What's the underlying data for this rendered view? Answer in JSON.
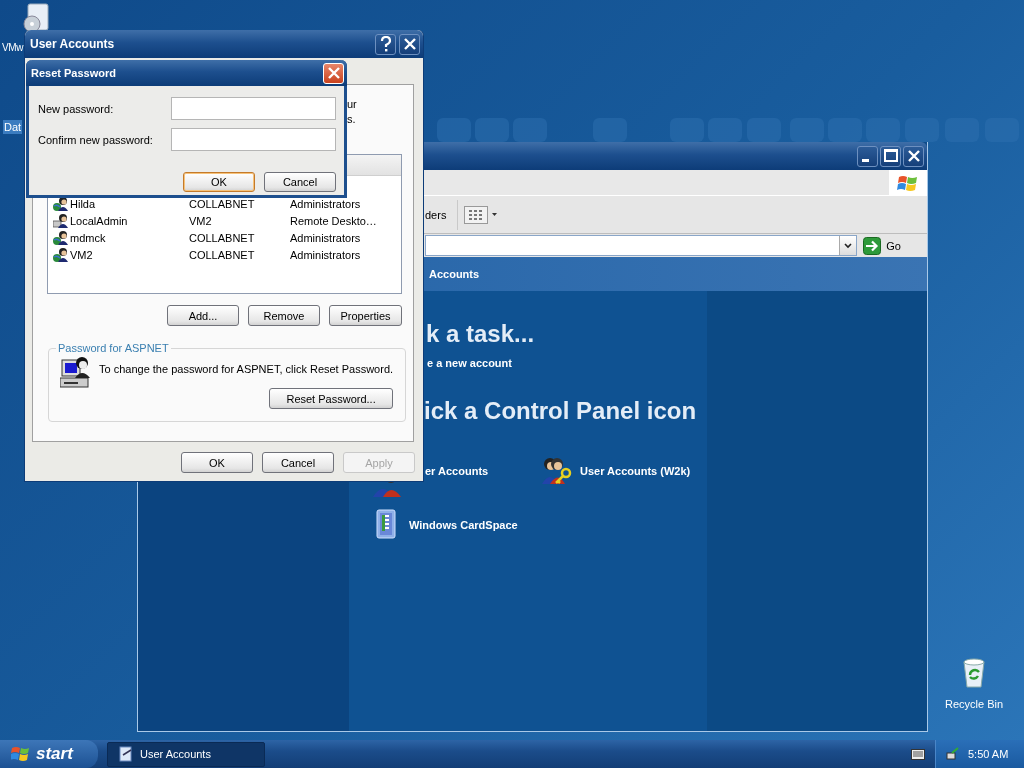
{
  "desktop_icons": [
    {
      "kind": "disc",
      "label": "VMw"
    },
    {
      "kind": "file",
      "label": "Dat"
    },
    {
      "kind": "bin",
      "label": "Recycle Bin"
    }
  ],
  "control_panel_window": {
    "toolbar_fragment": "ders",
    "go_label": "Go",
    "header": "Accounts",
    "task_heading": "k a task...",
    "task_link": "e a new account",
    "icon_heading": "ick a Control Panel icon",
    "icons": [
      {
        "kind": "users",
        "label": "er Accounts"
      },
      {
        "kind": "users-key",
        "label": "User Accounts (W2k)"
      },
      {
        "kind": "card",
        "label": "Windows CardSpace"
      }
    ]
  },
  "user_accounts_dialog": {
    "title": "User Accounts",
    "intro_fragments": [
      "ur",
      "s."
    ],
    "users": [
      {
        "name": "Hilda",
        "domain": "COLLABNET",
        "group": "Administrators",
        "kind": "domain"
      },
      {
        "name": "LocalAdmin",
        "domain": "VM2",
        "group": "Remote Deskto…",
        "kind": "local"
      },
      {
        "name": "mdmck",
        "domain": "COLLABNET",
        "group": "Administrators",
        "kind": "domain"
      },
      {
        "name": "VM2",
        "domain": "COLLABNET",
        "group": "Administrators",
        "kind": "domain"
      }
    ],
    "list_buttons": [
      "Add...",
      "Remove",
      "Properties"
    ],
    "group_title": "Password for ASPNET",
    "group_text": "To change the password for ASPNET, click Reset Password.",
    "reset_button": "Reset Password...",
    "buttons": [
      {
        "label": "OK",
        "disabled": false
      },
      {
        "label": "Cancel",
        "disabled": false
      },
      {
        "label": "Apply",
        "disabled": true
      }
    ]
  },
  "reset_password_dialog": {
    "title": "Reset Password",
    "fields": [
      {
        "label": "New password:"
      },
      {
        "label": "Confirm new password:"
      }
    ],
    "buttons": [
      {
        "label": "OK",
        "default": true
      },
      {
        "label": "Cancel",
        "default": false
      }
    ]
  },
  "taskbar": {
    "start": "start",
    "tasks": [
      {
        "label": "User Accounts"
      }
    ],
    "clock": "5:50 AM"
  }
}
